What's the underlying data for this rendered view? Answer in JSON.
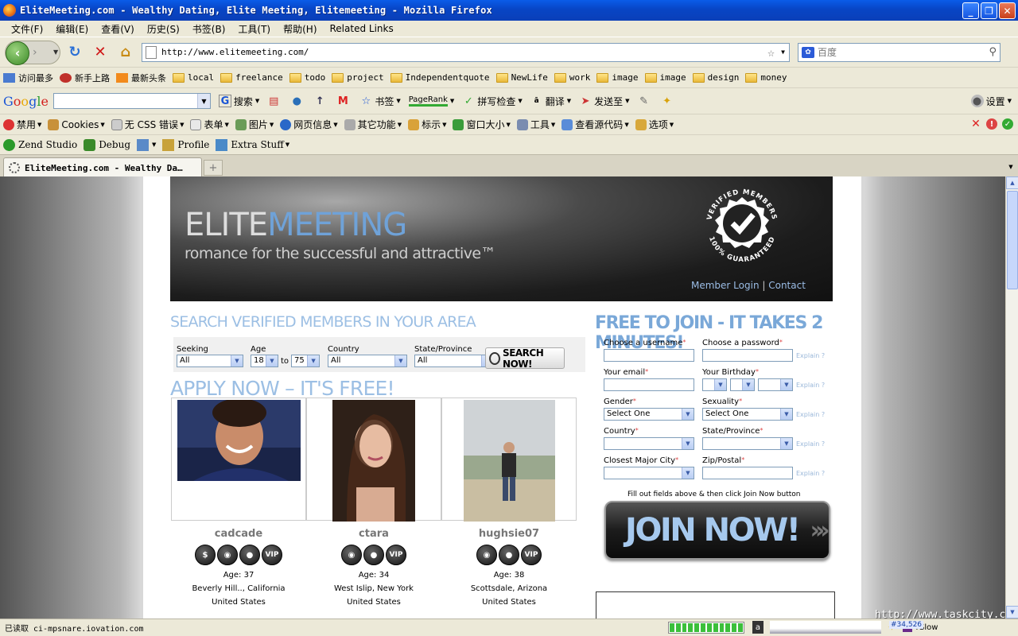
{
  "window": {
    "title": "EliteMeeting.com - Wealthy Dating, Elite Meeting, Elitemeeting - Mozilla Firefox",
    "minimize": "_",
    "maximize": "❐",
    "close": "✕"
  },
  "menu": [
    "文件(F)",
    "编辑(E)",
    "查看(V)",
    "历史(S)",
    "书签(B)",
    "工具(T)",
    "帮助(H)",
    "Related Links"
  ],
  "nav": {
    "url": "http://www.elitemeeting.com/",
    "search_placeholder": "百度"
  },
  "bookmarks": [
    {
      "label": "访问最多",
      "kind": "special"
    },
    {
      "label": "新手上路",
      "kind": "special"
    },
    {
      "label": "最新头条",
      "kind": "rss"
    },
    {
      "label": "local",
      "kind": "folder"
    },
    {
      "label": "freelance",
      "kind": "folder"
    },
    {
      "label": "todo",
      "kind": "folder"
    },
    {
      "label": "project",
      "kind": "folder"
    },
    {
      "label": "Independentquote",
      "kind": "folder"
    },
    {
      "label": "NewLife",
      "kind": "folder"
    },
    {
      "label": "work",
      "kind": "folder"
    },
    {
      "label": "image",
      "kind": "folder"
    },
    {
      "label": "image",
      "kind": "folder"
    },
    {
      "label": "design",
      "kind": "folder"
    },
    {
      "label": "money",
      "kind": "folder"
    }
  ],
  "google_toolbar": {
    "search_label": "搜索",
    "bookmarks_label": "书签",
    "pagerank_label": "PageRank",
    "spell_label": "拼写检查",
    "translate_label": "翻译",
    "sendto_label": "发送至",
    "settings_label": "设置"
  },
  "webdev_toolbar": [
    "禁用",
    "Cookies",
    "CSS 错误",
    "表单",
    "图片",
    "网页信息",
    "其它功能",
    "标示",
    "窗口大小",
    "工具",
    "查看源代码",
    "选项"
  ],
  "webdev_prefix": "无",
  "zend_toolbar": {
    "zend": "Zend Studio",
    "debug": "Debug",
    "profile": "Profile",
    "extra": "Extra Stuff"
  },
  "tab": {
    "label": "EliteMeeting.com - Wealthy Da…",
    "new_tab": "+"
  },
  "site": {
    "brand_elite": "ELITE",
    "brand_meeting": "MEETING",
    "tagline": "romance for the successful and attractive™",
    "badge_text_top": "VERIFIED MEMBERS",
    "badge_text_bottom": "100% GUARANTEED",
    "member_login": "Member Login",
    "separator": " | ",
    "contact": "Contact",
    "search_heading": "SEARCH VERIFIED MEMBERS IN  YOUR AREA",
    "apply_heading": "APPLY NOW – IT'S FREE!",
    "join_heading": "FREE TO JOIN - IT TAKES 2 MINUTES!",
    "search": {
      "seeking_label": "Seeking",
      "seeking_value": "All",
      "age_label": "Age",
      "age_from": "18",
      "age_to_word": "to",
      "age_to": "75",
      "country_label": "Country",
      "country_value": "All",
      "state_label": "State/Province",
      "state_value": "All",
      "button": "SEARCH NOW!"
    },
    "members": [
      {
        "name": "cadcade",
        "badges": [
          "$",
          "◉",
          "●",
          "VIP"
        ],
        "age": "Age: 37",
        "city": "Beverly Hill.., California",
        "country": "United States"
      },
      {
        "name": "ctara",
        "badges": [
          "◉",
          "●",
          "VIP"
        ],
        "age": "Age: 34",
        "city": "West Islip, New York",
        "country": "United States"
      },
      {
        "name": "hughsie07",
        "badges": [
          "◉",
          "●",
          "VIP"
        ],
        "age": "Age: 38",
        "city": "Scottsdale, Arizona",
        "country": "United States"
      }
    ],
    "form": {
      "username": "Choose a username",
      "password": "Choose a password",
      "email": "Your email",
      "birthday": "Your Birthday",
      "gender": "Gender",
      "gender_value": "Select One",
      "sexuality": "Sexuality",
      "sexuality_value": "Select One",
      "country": "Country",
      "state": "State/Province",
      "city": "Closest Major City",
      "zip": "Zip/Postal",
      "explain": "Explain ?",
      "required_mark": "*"
    },
    "fill_note": "Fill out fields above & then click Join Now button",
    "join_button": "JOIN NOW!",
    "join_chevrons": "›››"
  },
  "watermark": "http://www.taskcity.com",
  "status": {
    "text": "已读取 ci-mpsnare.iovation.com",
    "progress_cells": 12,
    "counter": "#34,526",
    "yslow": "YSlow"
  }
}
